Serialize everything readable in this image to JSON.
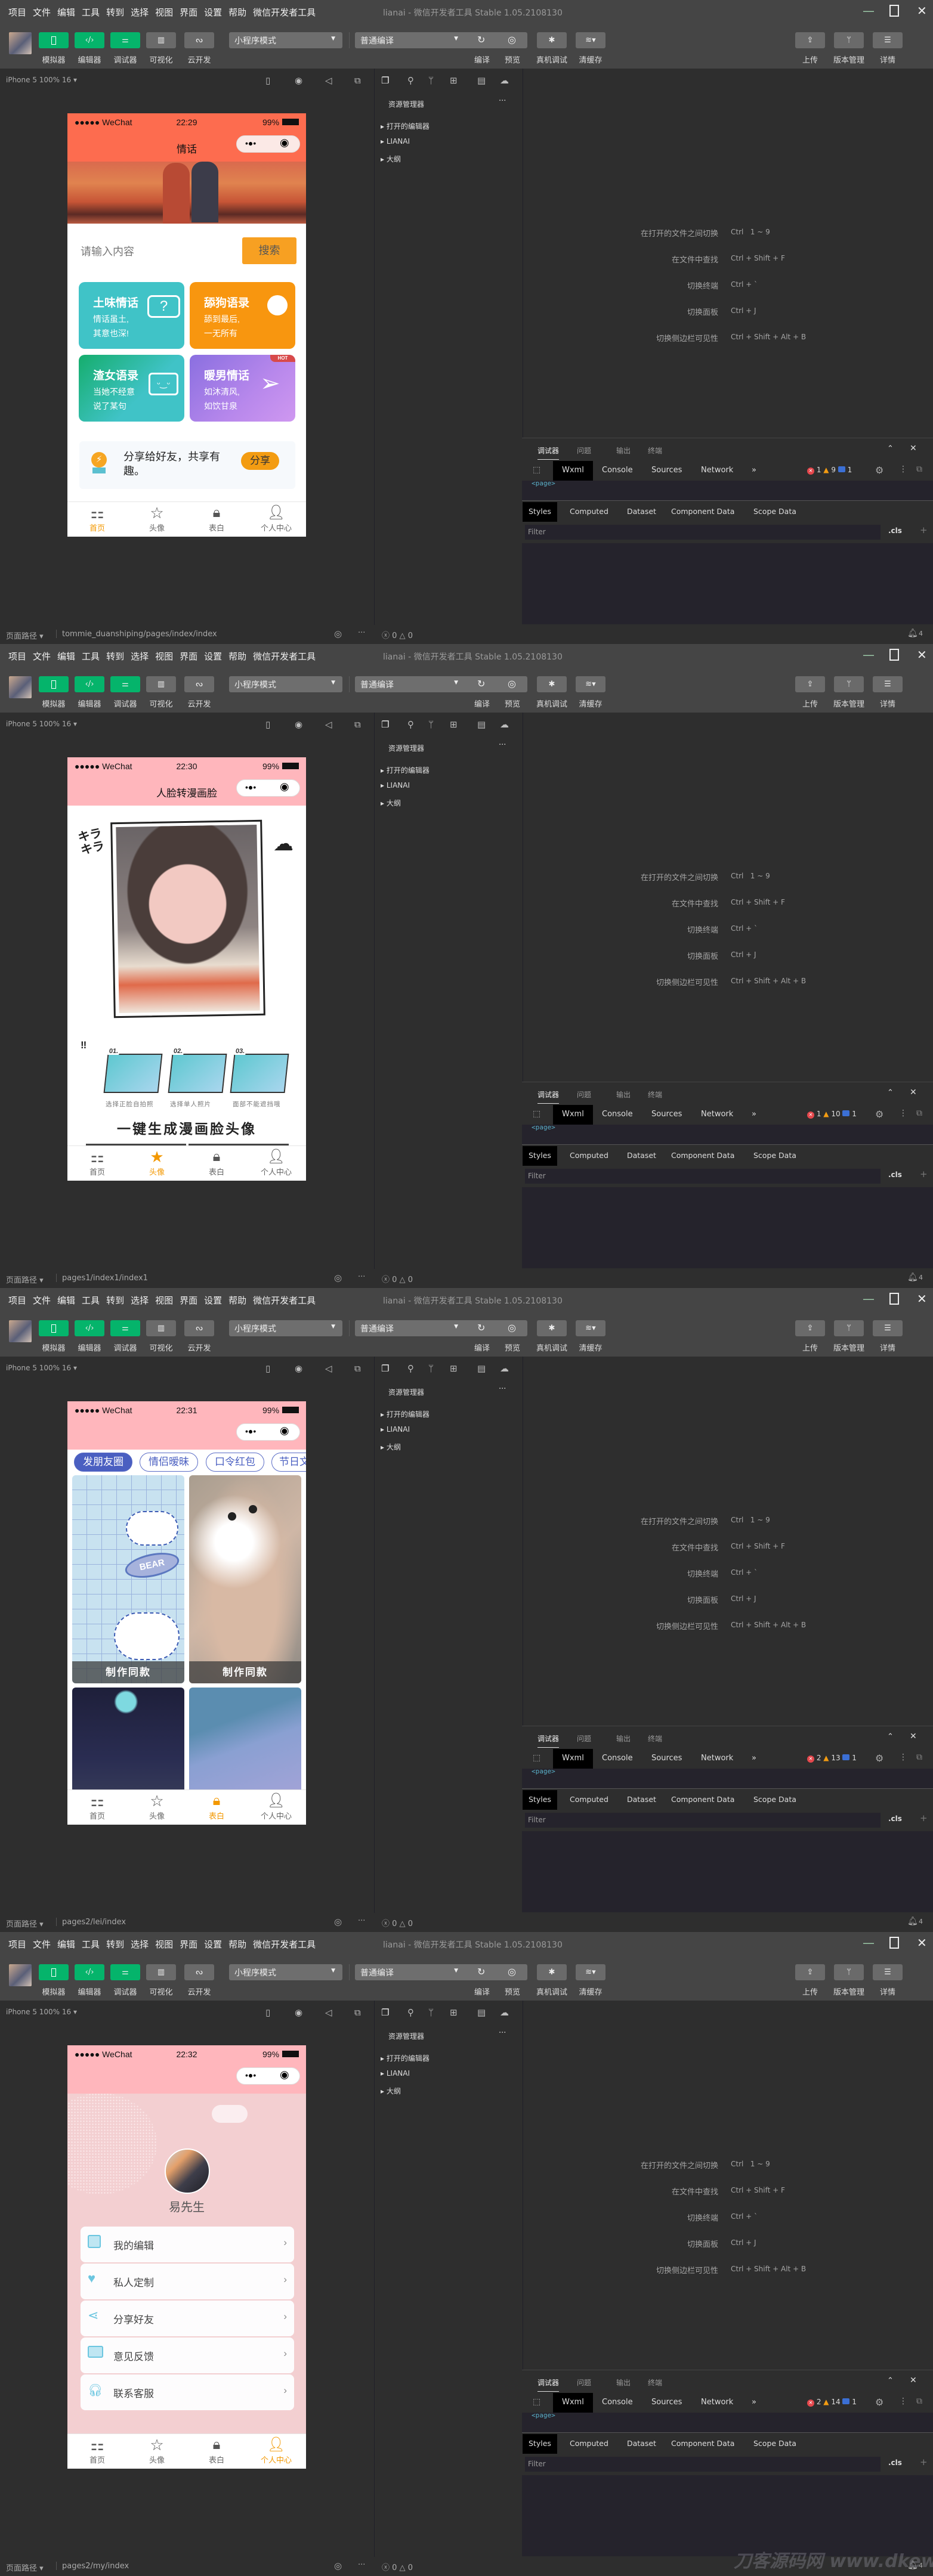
{
  "chrome": {
    "menu": [
      "项目",
      "文件",
      "编辑",
      "工具",
      "转到",
      "选择",
      "视图",
      "界面",
      "设置",
      "帮助",
      "微信开发者工具"
    ],
    "title": "lianai - 微信开发者工具 Stable 1.05.2108130",
    "tools": [
      "模拟器",
      "编辑器",
      "调试器",
      "可视化",
      "云开发"
    ],
    "mode": "小程序模式",
    "compile_mode": "普通编译",
    "actions": [
      "编译",
      "预览",
      "真机调试",
      "清缓存"
    ],
    "right_actions": [
      "上传",
      "版本管理",
      "详情"
    ],
    "device": "iPhone 5 100% 16",
    "explorer": {
      "title": "资源管理器",
      "more": "···",
      "items": [
        "打开的编辑器",
        "LIANAI",
        "大纲"
      ]
    },
    "shortcuts": [
      {
        "label": "在打开的文件之间切换",
        "keys": "Ctrl   1 ~ 9"
      },
      {
        "label": "在文件中查找",
        "keys": "Ctrl + Shift + F"
      },
      {
        "label": "切换终端",
        "keys": "Ctrl + `"
      },
      {
        "label": "切换面板",
        "keys": "Ctrl + J"
      },
      {
        "label": "切换侧边栏可见性",
        "keys": "Ctrl + Shift + Alt + B"
      }
    ],
    "devtools": {
      "tabs": [
        "调试器",
        "问题",
        "输出",
        "终端"
      ],
      "subtabs": [
        "Wxml",
        "Console",
        "Sources",
        "Network",
        "»"
      ],
      "node": "<page>",
      "style_tabs": [
        "Styles",
        "Computed",
        "Dataset",
        "Component Data",
        "Scope Data"
      ],
      "filter_placeholder": "Filter",
      "cls": ".cls",
      "plus": "+"
    },
    "status": {
      "path_label": "页面路径 ▾",
      "errors": "0",
      "warnings": "0",
      "bell": "4"
    },
    "accent_green": "#05b46b"
  },
  "phone_common": {
    "carrier": "●●●●● WeChat",
    "battery": "99%",
    "tabs": [
      "首页",
      "头像",
      "表白",
      "个人中心"
    ],
    "active_color": "#f39800"
  },
  "panels": [
    {
      "path": "tommie_duanshiping/pages/index/index",
      "badges": {
        "error": "1",
        "warn": "9",
        "info": "1"
      },
      "phone": {
        "time": "22:29",
        "title": "情话",
        "search_placeholder": "请输入内容",
        "search_button": "搜索",
        "cards": [
          {
            "title": "土味情话",
            "line1": "情话虽土,",
            "line2": "其意也深!"
          },
          {
            "title": "舔狗语录",
            "line1": "舔到最后,",
            "line2": "一无所有"
          },
          {
            "title": "渣女语录",
            "line1": "当她不经意",
            "line2": "说了某句"
          },
          {
            "title": "暖男情话",
            "line1": "如沐清风,",
            "line2": "如饮甘泉",
            "badge": "HOT"
          }
        ],
        "share_text": "分享给好友，共享有趣。",
        "share_button": "分享"
      }
    },
    {
      "path": "pages1/index1/index1",
      "badges": {
        "error": "1",
        "warn": "10",
        "info": "1"
      },
      "phone": {
        "time": "22:30",
        "title": "人脸转漫画脸",
        "doodle": "キラ キラ",
        "steps": [
          {
            "num": "01.",
            "label": "选择正脸自拍照"
          },
          {
            "num": "02.",
            "label": "选择单人照片"
          },
          {
            "num": "03.",
            "label": "面部不能遮挡哦"
          }
        ],
        "headline": "一键生成漫画脸头像"
      }
    },
    {
      "path": "pages2/lei/index",
      "badges": {
        "error": "2",
        "warn": "13",
        "info": "1"
      },
      "phone": {
        "time": "22:31",
        "categories": [
          "发朋友圈",
          "情侣暧昧",
          "口令红包",
          "节日文"
        ],
        "make_same": "制作同款",
        "bear_text": "BEAR"
      }
    },
    {
      "path": "pages2/my/index",
      "badges": {
        "error": "2",
        "warn": "14",
        "info": "1"
      },
      "phone": {
        "time": "22:32",
        "username": "易先生",
        "menu": [
          "我的编辑",
          "私人定制",
          "分享好友",
          "意见反馈",
          "联系客服"
        ]
      },
      "watermark": "刀客源码网 www.dkewl.com"
    }
  ]
}
